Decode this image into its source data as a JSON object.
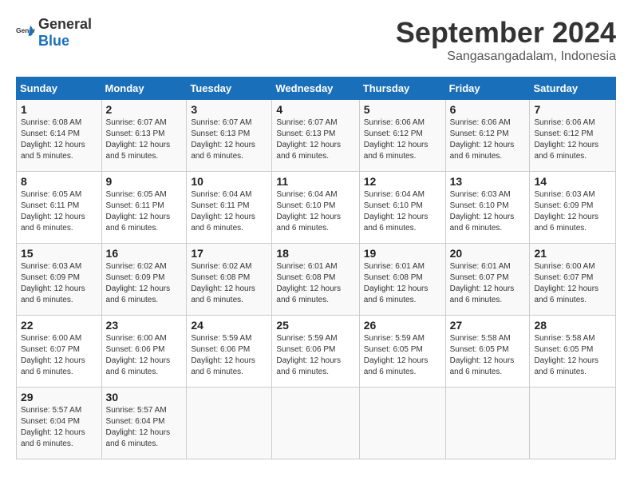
{
  "logo": {
    "text_general": "General",
    "text_blue": "Blue"
  },
  "title": "September 2024",
  "subtitle": "Sangasangadalam, Indonesia",
  "days_header": [
    "Sunday",
    "Monday",
    "Tuesday",
    "Wednesday",
    "Thursday",
    "Friday",
    "Saturday"
  ],
  "weeks": [
    [
      {
        "day": "1",
        "sunrise": "6:08 AM",
        "sunset": "6:14 PM",
        "daylight": "12 hours and 5 minutes."
      },
      {
        "day": "2",
        "sunrise": "6:07 AM",
        "sunset": "6:13 PM",
        "daylight": "12 hours and 5 minutes."
      },
      {
        "day": "3",
        "sunrise": "6:07 AM",
        "sunset": "6:13 PM",
        "daylight": "12 hours and 6 minutes."
      },
      {
        "day": "4",
        "sunrise": "6:07 AM",
        "sunset": "6:13 PM",
        "daylight": "12 hours and 6 minutes."
      },
      {
        "day": "5",
        "sunrise": "6:06 AM",
        "sunset": "6:12 PM",
        "daylight": "12 hours and 6 minutes."
      },
      {
        "day": "6",
        "sunrise": "6:06 AM",
        "sunset": "6:12 PM",
        "daylight": "12 hours and 6 minutes."
      },
      {
        "day": "7",
        "sunrise": "6:06 AM",
        "sunset": "6:12 PM",
        "daylight": "12 hours and 6 minutes."
      }
    ],
    [
      {
        "day": "8",
        "sunrise": "6:05 AM",
        "sunset": "6:11 PM",
        "daylight": "12 hours and 6 minutes."
      },
      {
        "day": "9",
        "sunrise": "6:05 AM",
        "sunset": "6:11 PM",
        "daylight": "12 hours and 6 minutes."
      },
      {
        "day": "10",
        "sunrise": "6:04 AM",
        "sunset": "6:11 PM",
        "daylight": "12 hours and 6 minutes."
      },
      {
        "day": "11",
        "sunrise": "6:04 AM",
        "sunset": "6:10 PM",
        "daylight": "12 hours and 6 minutes."
      },
      {
        "day": "12",
        "sunrise": "6:04 AM",
        "sunset": "6:10 PM",
        "daylight": "12 hours and 6 minutes."
      },
      {
        "day": "13",
        "sunrise": "6:03 AM",
        "sunset": "6:10 PM",
        "daylight": "12 hours and 6 minutes."
      },
      {
        "day": "14",
        "sunrise": "6:03 AM",
        "sunset": "6:09 PM",
        "daylight": "12 hours and 6 minutes."
      }
    ],
    [
      {
        "day": "15",
        "sunrise": "6:03 AM",
        "sunset": "6:09 PM",
        "daylight": "12 hours and 6 minutes."
      },
      {
        "day": "16",
        "sunrise": "6:02 AM",
        "sunset": "6:09 PM",
        "daylight": "12 hours and 6 minutes."
      },
      {
        "day": "17",
        "sunrise": "6:02 AM",
        "sunset": "6:08 PM",
        "daylight": "12 hours and 6 minutes."
      },
      {
        "day": "18",
        "sunrise": "6:01 AM",
        "sunset": "6:08 PM",
        "daylight": "12 hours and 6 minutes."
      },
      {
        "day": "19",
        "sunrise": "6:01 AM",
        "sunset": "6:08 PM",
        "daylight": "12 hours and 6 minutes."
      },
      {
        "day": "20",
        "sunrise": "6:01 AM",
        "sunset": "6:07 PM",
        "daylight": "12 hours and 6 minutes."
      },
      {
        "day": "21",
        "sunrise": "6:00 AM",
        "sunset": "6:07 PM",
        "daylight": "12 hours and 6 minutes."
      }
    ],
    [
      {
        "day": "22",
        "sunrise": "6:00 AM",
        "sunset": "6:07 PM",
        "daylight": "12 hours and 6 minutes."
      },
      {
        "day": "23",
        "sunrise": "6:00 AM",
        "sunset": "6:06 PM",
        "daylight": "12 hours and 6 minutes."
      },
      {
        "day": "24",
        "sunrise": "5:59 AM",
        "sunset": "6:06 PM",
        "daylight": "12 hours and 6 minutes."
      },
      {
        "day": "25",
        "sunrise": "5:59 AM",
        "sunset": "6:06 PM",
        "daylight": "12 hours and 6 minutes."
      },
      {
        "day": "26",
        "sunrise": "5:59 AM",
        "sunset": "6:05 PM",
        "daylight": "12 hours and 6 minutes."
      },
      {
        "day": "27",
        "sunrise": "5:58 AM",
        "sunset": "6:05 PM",
        "daylight": "12 hours and 6 minutes."
      },
      {
        "day": "28",
        "sunrise": "5:58 AM",
        "sunset": "6:05 PM",
        "daylight": "12 hours and 6 minutes."
      }
    ],
    [
      {
        "day": "29",
        "sunrise": "5:57 AM",
        "sunset": "6:04 PM",
        "daylight": "12 hours and 6 minutes."
      },
      {
        "day": "30",
        "sunrise": "5:57 AM",
        "sunset": "6:04 PM",
        "daylight": "12 hours and 6 minutes."
      },
      null,
      null,
      null,
      null,
      null
    ]
  ]
}
